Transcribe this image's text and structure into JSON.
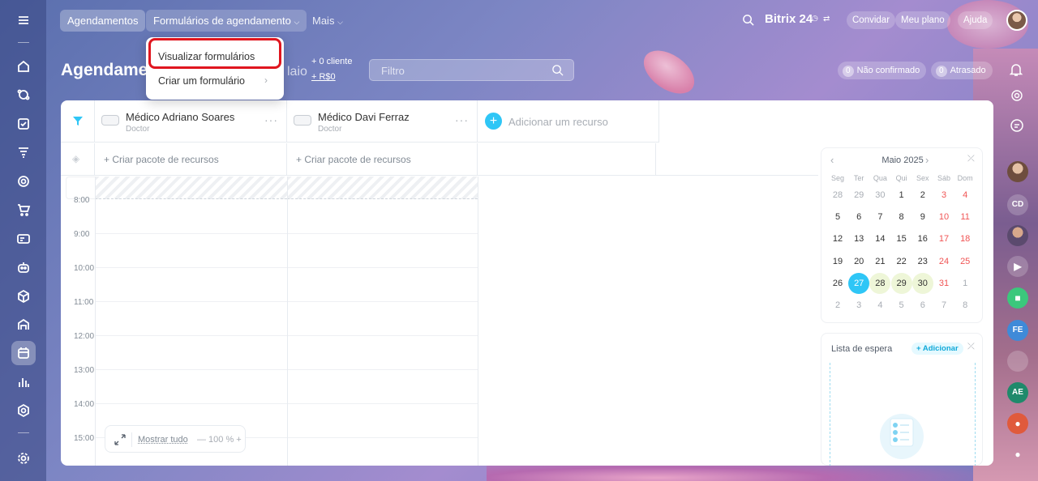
{
  "topbar": {
    "tab_bookings": "Agendamentos",
    "tab_forms": "Formulários de agendamento",
    "tab_more": "Mais",
    "brand": "Bitrix 24",
    "invite": "Convidar",
    "my_plan": "Meu plano",
    "help": "Ajuda"
  },
  "dropdown": {
    "item_view": "Visualizar formulários",
    "item_create": "Criar um formulário"
  },
  "header": {
    "title": "Agendame",
    "month_ghost": "laio",
    "stat_clients": "+ 0 cliente",
    "stat_money": "+ R$0",
    "filter_placeholder": "Filtro",
    "chip_unconfirmed_count": "0",
    "chip_unconfirmed": "Não confirmado",
    "chip_late_count": "0",
    "chip_late": "Atrasado"
  },
  "resources": [
    {
      "name": "Médico Adriano Soares",
      "role": "Doctor"
    },
    {
      "name": "Médico Davi Ferraz",
      "role": "Doctor"
    }
  ],
  "add_resource": "Adicionar um recurso",
  "create_pack": "+ Criar pacote de recursos",
  "times": [
    "8:00",
    "9:00",
    "10:00",
    "11:00",
    "12:00",
    "13:00",
    "14:00",
    "15:00"
  ],
  "calendar": {
    "month": "Maio 2025",
    "dow": [
      "Seg",
      "Ter",
      "Qua",
      "Qui",
      "Sex",
      "Sáb",
      "Dom"
    ],
    "weeks": [
      [
        "28",
        "29",
        "30",
        "1",
        "2",
        "3",
        "4"
      ],
      [
        "5",
        "6",
        "7",
        "8",
        "9",
        "10",
        "11"
      ],
      [
        "12",
        "13",
        "14",
        "15",
        "16",
        "17",
        "18"
      ],
      [
        "19",
        "20",
        "21",
        "22",
        "23",
        "24",
        "25"
      ],
      [
        "26",
        "27",
        "28",
        "29",
        "30",
        "31",
        "1"
      ],
      [
        "2",
        "3",
        "4",
        "5",
        "6",
        "7",
        "8"
      ]
    ],
    "today": "27"
  },
  "waitlist": {
    "title": "Lista de espera",
    "add": "+ Adicionar"
  },
  "zoom": {
    "show_all": "Mostrar tudo",
    "value": "— 100 % +"
  },
  "right_avatars": [
    "CD",
    "FE",
    "AE"
  ],
  "colors": {
    "accent": "#2fc6f6",
    "weekend": "#f05454",
    "highlight": "#e0161f"
  }
}
